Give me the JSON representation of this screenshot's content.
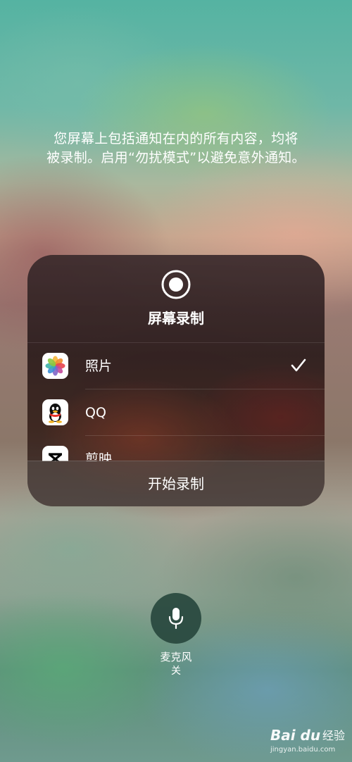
{
  "notice": {
    "line1": "您屏幕上包括通知在内的所有内容，均将",
    "line2": "被录制。启用“勿扰模式”以避免意外通知。"
  },
  "panel": {
    "icon": "screen-record-icon",
    "title": "屏幕录制",
    "apps": [
      {
        "label": "照片",
        "icon": "photos-app-icon",
        "selected": true
      },
      {
        "label": "QQ",
        "icon": "qq-app-icon",
        "selected": false
      },
      {
        "label": "剪映",
        "icon": "capcut-app-icon",
        "selected": false
      }
    ],
    "start_label": "开始录制"
  },
  "microphone": {
    "icon": "microphone-icon",
    "label": "麦克风",
    "state": "关"
  },
  "watermark": {
    "logo": "Bai du",
    "brand": "经验",
    "url": "jingyan.baidu.com"
  },
  "colors": {
    "panel_bg": "#2e1e1e",
    "mic_button_bg": "#28483e",
    "text": "#ffffff"
  }
}
